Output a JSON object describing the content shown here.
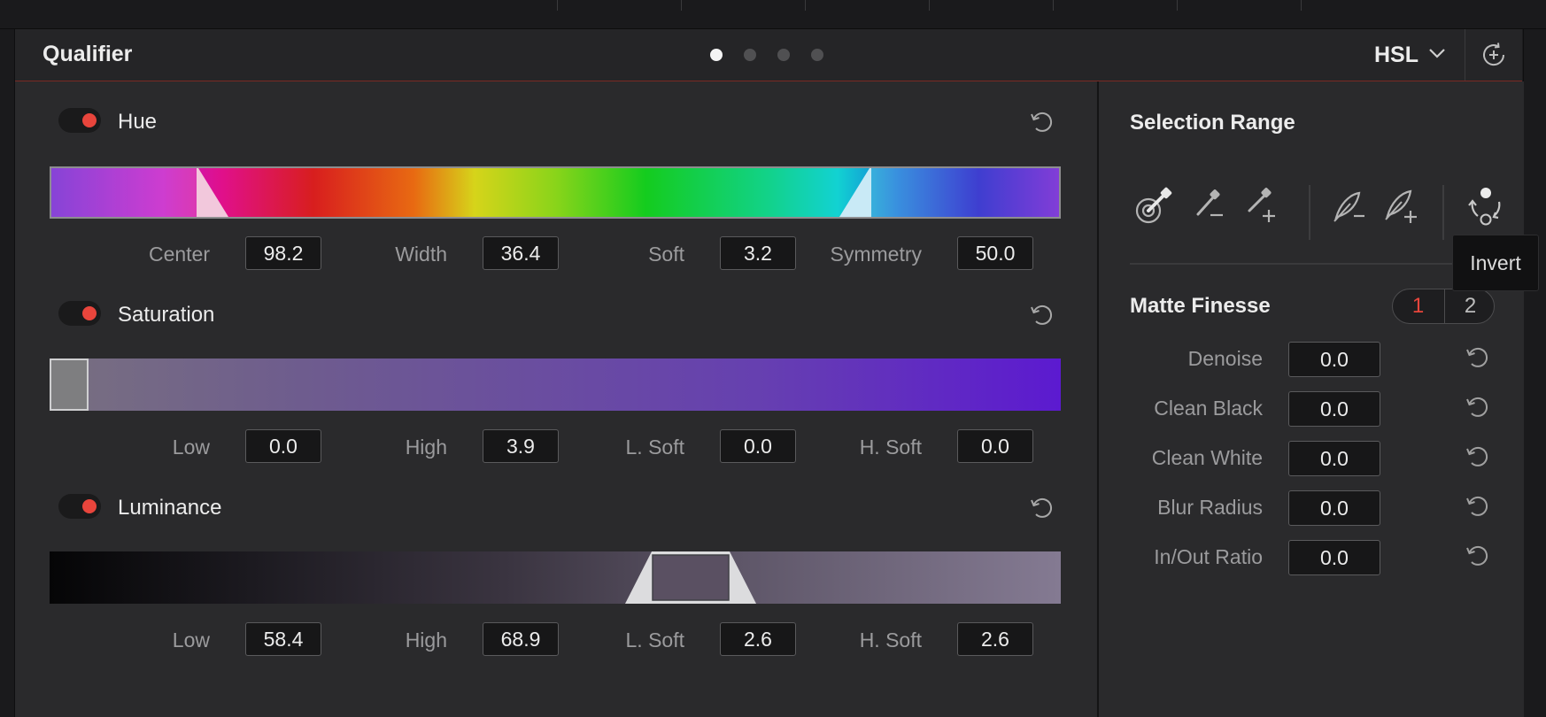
{
  "header": {
    "title": "Qualifier",
    "mode": "HSL",
    "page_dots": {
      "count": 4,
      "active_index": 0
    }
  },
  "hue": {
    "label": "Hue",
    "fields": [
      {
        "label": "Center",
        "value": "98.2"
      },
      {
        "label": "Width",
        "value": "36.4"
      },
      {
        "label": "Soft",
        "value": "3.2"
      },
      {
        "label": "Symmetry",
        "value": "50.0"
      }
    ]
  },
  "saturation": {
    "label": "Saturation",
    "fields": [
      {
        "label": "Low",
        "value": "0.0"
      },
      {
        "label": "High",
        "value": "3.9"
      },
      {
        "label": "L. Soft",
        "value": "0.0"
      },
      {
        "label": "H. Soft",
        "value": "0.0"
      }
    ]
  },
  "luminance": {
    "label": "Luminance",
    "fields": [
      {
        "label": "Low",
        "value": "58.4"
      },
      {
        "label": "High",
        "value": "68.9"
      },
      {
        "label": "L. Soft",
        "value": "2.6"
      },
      {
        "label": "H. Soft",
        "value": "2.6"
      }
    ]
  },
  "selection_range": {
    "title": "Selection Range",
    "tools": [
      "picker-icon",
      "picker-minus-icon",
      "picker-plus-icon",
      "feather-minus-icon",
      "feather-plus-icon",
      "invert-icon"
    ],
    "tooltip": "Invert"
  },
  "matte_finesse": {
    "title": "Matte Finesse",
    "tabs": [
      "1",
      "2"
    ],
    "active_tab": "1",
    "rows": [
      {
        "label": "Denoise",
        "value": "0.0"
      },
      {
        "label": "Clean Black",
        "value": "0.0"
      },
      {
        "label": "Clean White",
        "value": "0.0"
      },
      {
        "label": "Blur Radius",
        "value": "0.0"
      },
      {
        "label": "In/Out Ratio",
        "value": "0.0"
      }
    ]
  },
  "colors": {
    "accent_red": "#e8453c",
    "panel_bg": "#2a2a2c",
    "field_bg": "#171718"
  }
}
